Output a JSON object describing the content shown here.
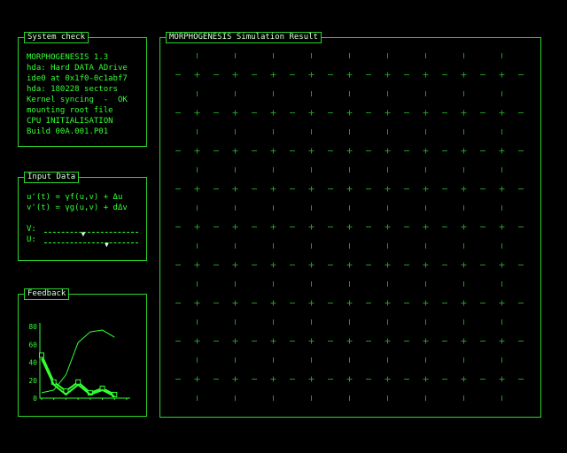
{
  "system_check": {
    "title": "System check",
    "lines": [
      "MORPHOGENESIS 1.3",
      "hda: Hard DATA ADrive",
      "ide0 at 0x1f0-0c1abf7",
      "hda: 180228 sectors",
      "Kernel syncing  -  OK",
      "mounting root file",
      "CPU INITIALISATION",
      "Build 00A.001.P01"
    ]
  },
  "input_data": {
    "title": "Input Data",
    "eq_u": "u'(t) = γf(u,v) + Δu",
    "eq_v": "v'(t) = γg(u,v) + dΔv",
    "slider_v": {
      "label": "V:",
      "value": 0.42
    },
    "slider_u": {
      "label": "U:",
      "value": 0.67
    },
    "thumb_glyph": "▼"
  },
  "feedback": {
    "title": "Feedback"
  },
  "simulation": {
    "title": "MORPHOGENESIS Simulation Result"
  },
  "colors": {
    "background": "#000000",
    "accent": "#33ff33",
    "border": "#2bd62b",
    "grid": "#1f9a1f"
  },
  "chart_data": {
    "type": "line",
    "title": "",
    "xlabel": "",
    "ylabel": "",
    "ylim": [
      0,
      80
    ],
    "yticks": [
      0,
      20,
      40,
      60,
      80
    ],
    "x": [
      0,
      1,
      2,
      3,
      4,
      5,
      6,
      7
    ],
    "series": [
      {
        "values": [
          48,
          18,
          8,
          18,
          6,
          11,
          4,
          0
        ],
        "markers": true
      },
      {
        "values": [
          44,
          15,
          4,
          15,
          4,
          9,
          2,
          0
        ],
        "markers": false
      },
      {
        "x": [
          0,
          1,
          2,
          3,
          4,
          5,
          6,
          7
        ],
        "values": [
          6,
          9,
          26,
          62,
          74,
          76,
          68,
          0
        ],
        "markers": false,
        "thin": true
      }
    ]
  }
}
